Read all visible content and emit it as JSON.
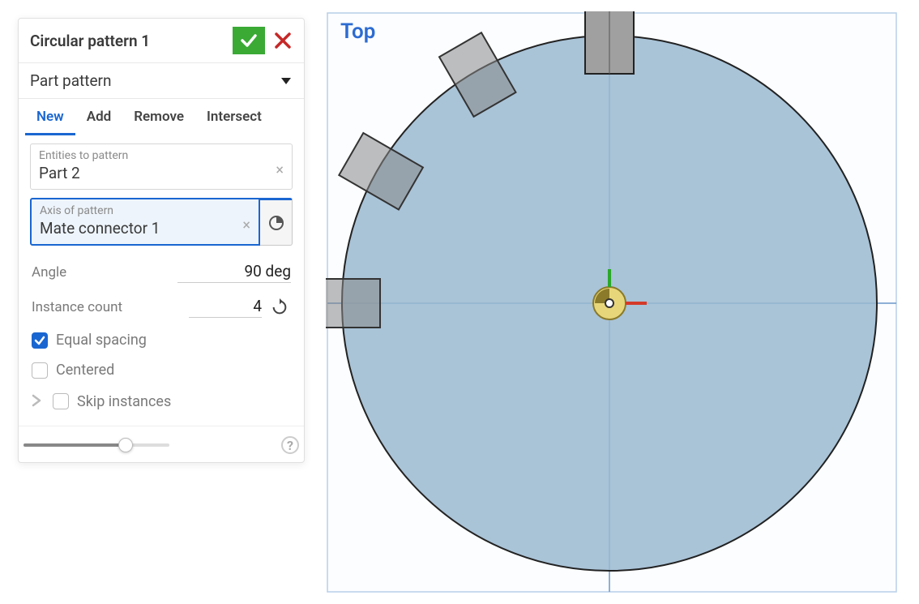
{
  "panel": {
    "title": "Circular pattern 1",
    "pattern_type": "Part pattern",
    "tabs": {
      "new": "New",
      "add": "Add",
      "remove": "Remove",
      "intersect": "Intersect"
    },
    "entities": {
      "label": "Entities to pattern",
      "value": "Part 2"
    },
    "axis": {
      "label": "Axis of pattern",
      "value": "Mate connector 1"
    },
    "angle": {
      "label": "Angle",
      "value": "90 deg"
    },
    "instance_count": {
      "label": "Instance count",
      "value": "4"
    },
    "equal_spacing": "Equal spacing",
    "centered": "Centered",
    "skip_instances": "Skip instances"
  },
  "viewport": {
    "label": "Top"
  }
}
